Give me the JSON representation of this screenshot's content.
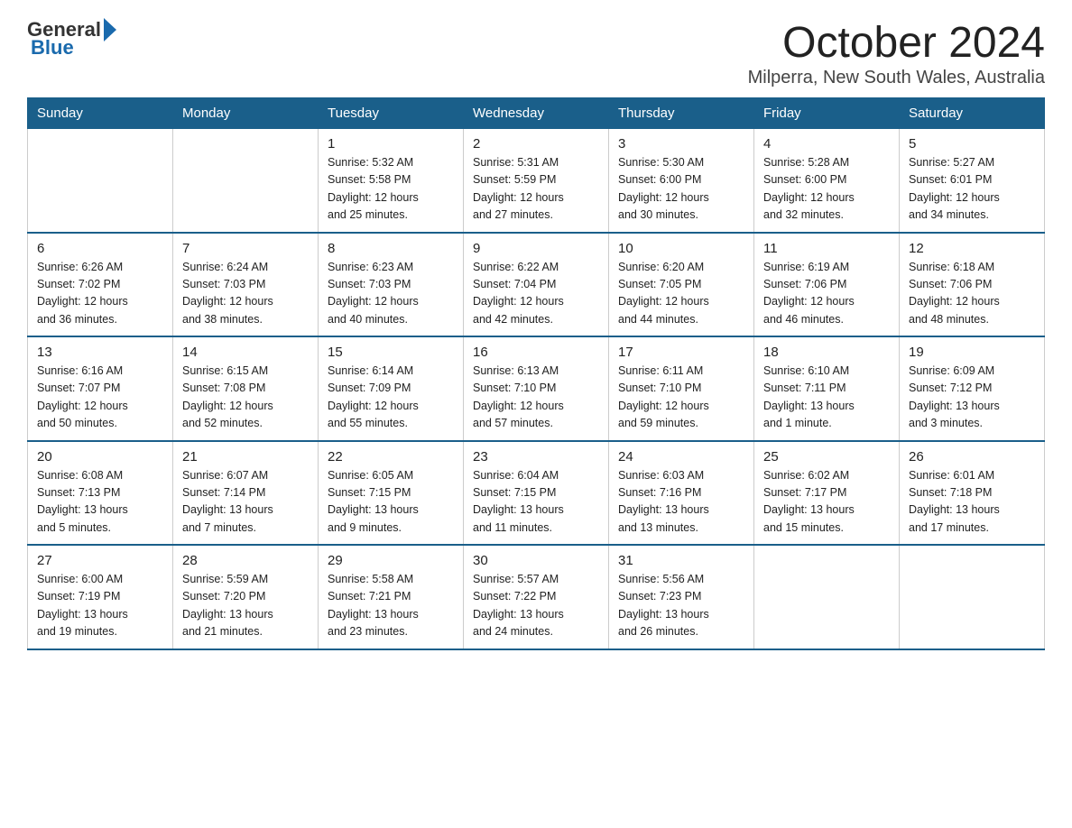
{
  "header": {
    "logo_text_general": "General",
    "logo_text_blue": "Blue",
    "month_title": "October 2024",
    "location": "Milperra, New South Wales, Australia"
  },
  "days_of_week": [
    "Sunday",
    "Monday",
    "Tuesday",
    "Wednesday",
    "Thursday",
    "Friday",
    "Saturday"
  ],
  "weeks": [
    [
      {
        "day": "",
        "info": ""
      },
      {
        "day": "",
        "info": ""
      },
      {
        "day": "1",
        "info": "Sunrise: 5:32 AM\nSunset: 5:58 PM\nDaylight: 12 hours\nand 25 minutes."
      },
      {
        "day": "2",
        "info": "Sunrise: 5:31 AM\nSunset: 5:59 PM\nDaylight: 12 hours\nand 27 minutes."
      },
      {
        "day": "3",
        "info": "Sunrise: 5:30 AM\nSunset: 6:00 PM\nDaylight: 12 hours\nand 30 minutes."
      },
      {
        "day": "4",
        "info": "Sunrise: 5:28 AM\nSunset: 6:00 PM\nDaylight: 12 hours\nand 32 minutes."
      },
      {
        "day": "5",
        "info": "Sunrise: 5:27 AM\nSunset: 6:01 PM\nDaylight: 12 hours\nand 34 minutes."
      }
    ],
    [
      {
        "day": "6",
        "info": "Sunrise: 6:26 AM\nSunset: 7:02 PM\nDaylight: 12 hours\nand 36 minutes."
      },
      {
        "day": "7",
        "info": "Sunrise: 6:24 AM\nSunset: 7:03 PM\nDaylight: 12 hours\nand 38 minutes."
      },
      {
        "day": "8",
        "info": "Sunrise: 6:23 AM\nSunset: 7:03 PM\nDaylight: 12 hours\nand 40 minutes."
      },
      {
        "day": "9",
        "info": "Sunrise: 6:22 AM\nSunset: 7:04 PM\nDaylight: 12 hours\nand 42 minutes."
      },
      {
        "day": "10",
        "info": "Sunrise: 6:20 AM\nSunset: 7:05 PM\nDaylight: 12 hours\nand 44 minutes."
      },
      {
        "day": "11",
        "info": "Sunrise: 6:19 AM\nSunset: 7:06 PM\nDaylight: 12 hours\nand 46 minutes."
      },
      {
        "day": "12",
        "info": "Sunrise: 6:18 AM\nSunset: 7:06 PM\nDaylight: 12 hours\nand 48 minutes."
      }
    ],
    [
      {
        "day": "13",
        "info": "Sunrise: 6:16 AM\nSunset: 7:07 PM\nDaylight: 12 hours\nand 50 minutes."
      },
      {
        "day": "14",
        "info": "Sunrise: 6:15 AM\nSunset: 7:08 PM\nDaylight: 12 hours\nand 52 minutes."
      },
      {
        "day": "15",
        "info": "Sunrise: 6:14 AM\nSunset: 7:09 PM\nDaylight: 12 hours\nand 55 minutes."
      },
      {
        "day": "16",
        "info": "Sunrise: 6:13 AM\nSunset: 7:10 PM\nDaylight: 12 hours\nand 57 minutes."
      },
      {
        "day": "17",
        "info": "Sunrise: 6:11 AM\nSunset: 7:10 PM\nDaylight: 12 hours\nand 59 minutes."
      },
      {
        "day": "18",
        "info": "Sunrise: 6:10 AM\nSunset: 7:11 PM\nDaylight: 13 hours\nand 1 minute."
      },
      {
        "day": "19",
        "info": "Sunrise: 6:09 AM\nSunset: 7:12 PM\nDaylight: 13 hours\nand 3 minutes."
      }
    ],
    [
      {
        "day": "20",
        "info": "Sunrise: 6:08 AM\nSunset: 7:13 PM\nDaylight: 13 hours\nand 5 minutes."
      },
      {
        "day": "21",
        "info": "Sunrise: 6:07 AM\nSunset: 7:14 PM\nDaylight: 13 hours\nand 7 minutes."
      },
      {
        "day": "22",
        "info": "Sunrise: 6:05 AM\nSunset: 7:15 PM\nDaylight: 13 hours\nand 9 minutes."
      },
      {
        "day": "23",
        "info": "Sunrise: 6:04 AM\nSunset: 7:15 PM\nDaylight: 13 hours\nand 11 minutes."
      },
      {
        "day": "24",
        "info": "Sunrise: 6:03 AM\nSunset: 7:16 PM\nDaylight: 13 hours\nand 13 minutes."
      },
      {
        "day": "25",
        "info": "Sunrise: 6:02 AM\nSunset: 7:17 PM\nDaylight: 13 hours\nand 15 minutes."
      },
      {
        "day": "26",
        "info": "Sunrise: 6:01 AM\nSunset: 7:18 PM\nDaylight: 13 hours\nand 17 minutes."
      }
    ],
    [
      {
        "day": "27",
        "info": "Sunrise: 6:00 AM\nSunset: 7:19 PM\nDaylight: 13 hours\nand 19 minutes."
      },
      {
        "day": "28",
        "info": "Sunrise: 5:59 AM\nSunset: 7:20 PM\nDaylight: 13 hours\nand 21 minutes."
      },
      {
        "day": "29",
        "info": "Sunrise: 5:58 AM\nSunset: 7:21 PM\nDaylight: 13 hours\nand 23 minutes."
      },
      {
        "day": "30",
        "info": "Sunrise: 5:57 AM\nSunset: 7:22 PM\nDaylight: 13 hours\nand 24 minutes."
      },
      {
        "day": "31",
        "info": "Sunrise: 5:56 AM\nSunset: 7:23 PM\nDaylight: 13 hours\nand 26 minutes."
      },
      {
        "day": "",
        "info": ""
      },
      {
        "day": "",
        "info": ""
      }
    ]
  ]
}
